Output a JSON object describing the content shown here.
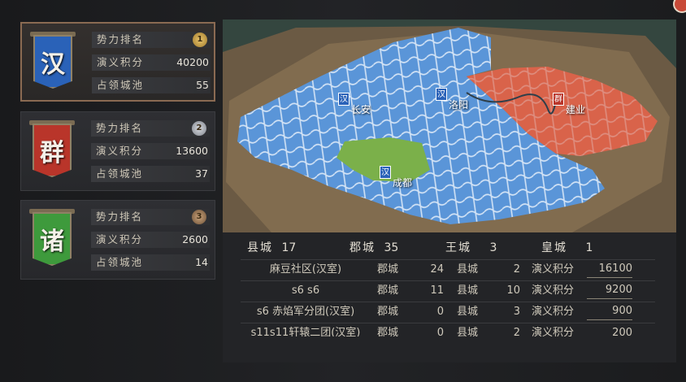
{
  "factions": [
    {
      "glyph": "汉",
      "color": "#2a62b8",
      "rank_label": "势力排名",
      "rank": "1",
      "rank_color": "#c9a14a",
      "score_label": "演义积分",
      "score": "40200",
      "cities_label": "占领城池",
      "cities": "55"
    },
    {
      "glyph": "群",
      "color": "#b9352a",
      "rank_label": "势力排名",
      "rank": "2",
      "rank_color": "#a9acb2",
      "score_label": "演义积分",
      "score": "13600",
      "cities_label": "占领城池",
      "cities": "37"
    },
    {
      "glyph": "诸",
      "color": "#3e9a3c",
      "rank_label": "势力排名",
      "rank": "3",
      "rank_color": "#9a7b5a",
      "score_label": "演义积分",
      "score": "2600",
      "cities_label": "占领城池",
      "cities": "14"
    }
  ],
  "map": {
    "cities": [
      {
        "name": "长安",
        "flag": "汉",
        "flag_color": "#2a62b8"
      },
      {
        "name": "洛阳",
        "flag": "汉",
        "flag_color": "#2a62b8"
      },
      {
        "name": "建业",
        "flag": "群",
        "flag_color": "#b9352a"
      },
      {
        "name": "成都",
        "flag": "汉",
        "flag_color": "#2a62b8"
      }
    ],
    "region_colors": {
      "han": "#5a95d8",
      "qun": "#d9634a",
      "zhu": "#7bb04a"
    }
  },
  "summary": {
    "county_label": "县城",
    "county": "17",
    "commandery_label": "郡城",
    "commandery": "35",
    "king_label": "王城",
    "king": "3",
    "imperial_label": "皇城",
    "imperial": "1"
  },
  "members": [
    {
      "name": "麻豆社区(汉室)",
      "jun_label": "郡城",
      "jun": "24",
      "xian_label": "县城",
      "xian": "2",
      "score_label": "演义积分",
      "score": "16100"
    },
    {
      "name": "s6 s6",
      "jun_label": "郡城",
      "jun": "11",
      "xian_label": "县城",
      "xian": "10",
      "score_label": "演义积分",
      "score": "9200"
    },
    {
      "name": "s6 赤焰军分团(汉室)",
      "jun_label": "郡城",
      "jun": "0",
      "xian_label": "县城",
      "xian": "3",
      "score_label": "演义积分",
      "score": "900"
    },
    {
      "name": "s11s11轩辕二团(汉室)",
      "jun_label": "郡城",
      "jun": "0",
      "xian_label": "县城",
      "xian": "2",
      "score_label": "演义积分",
      "score": "200"
    }
  ]
}
